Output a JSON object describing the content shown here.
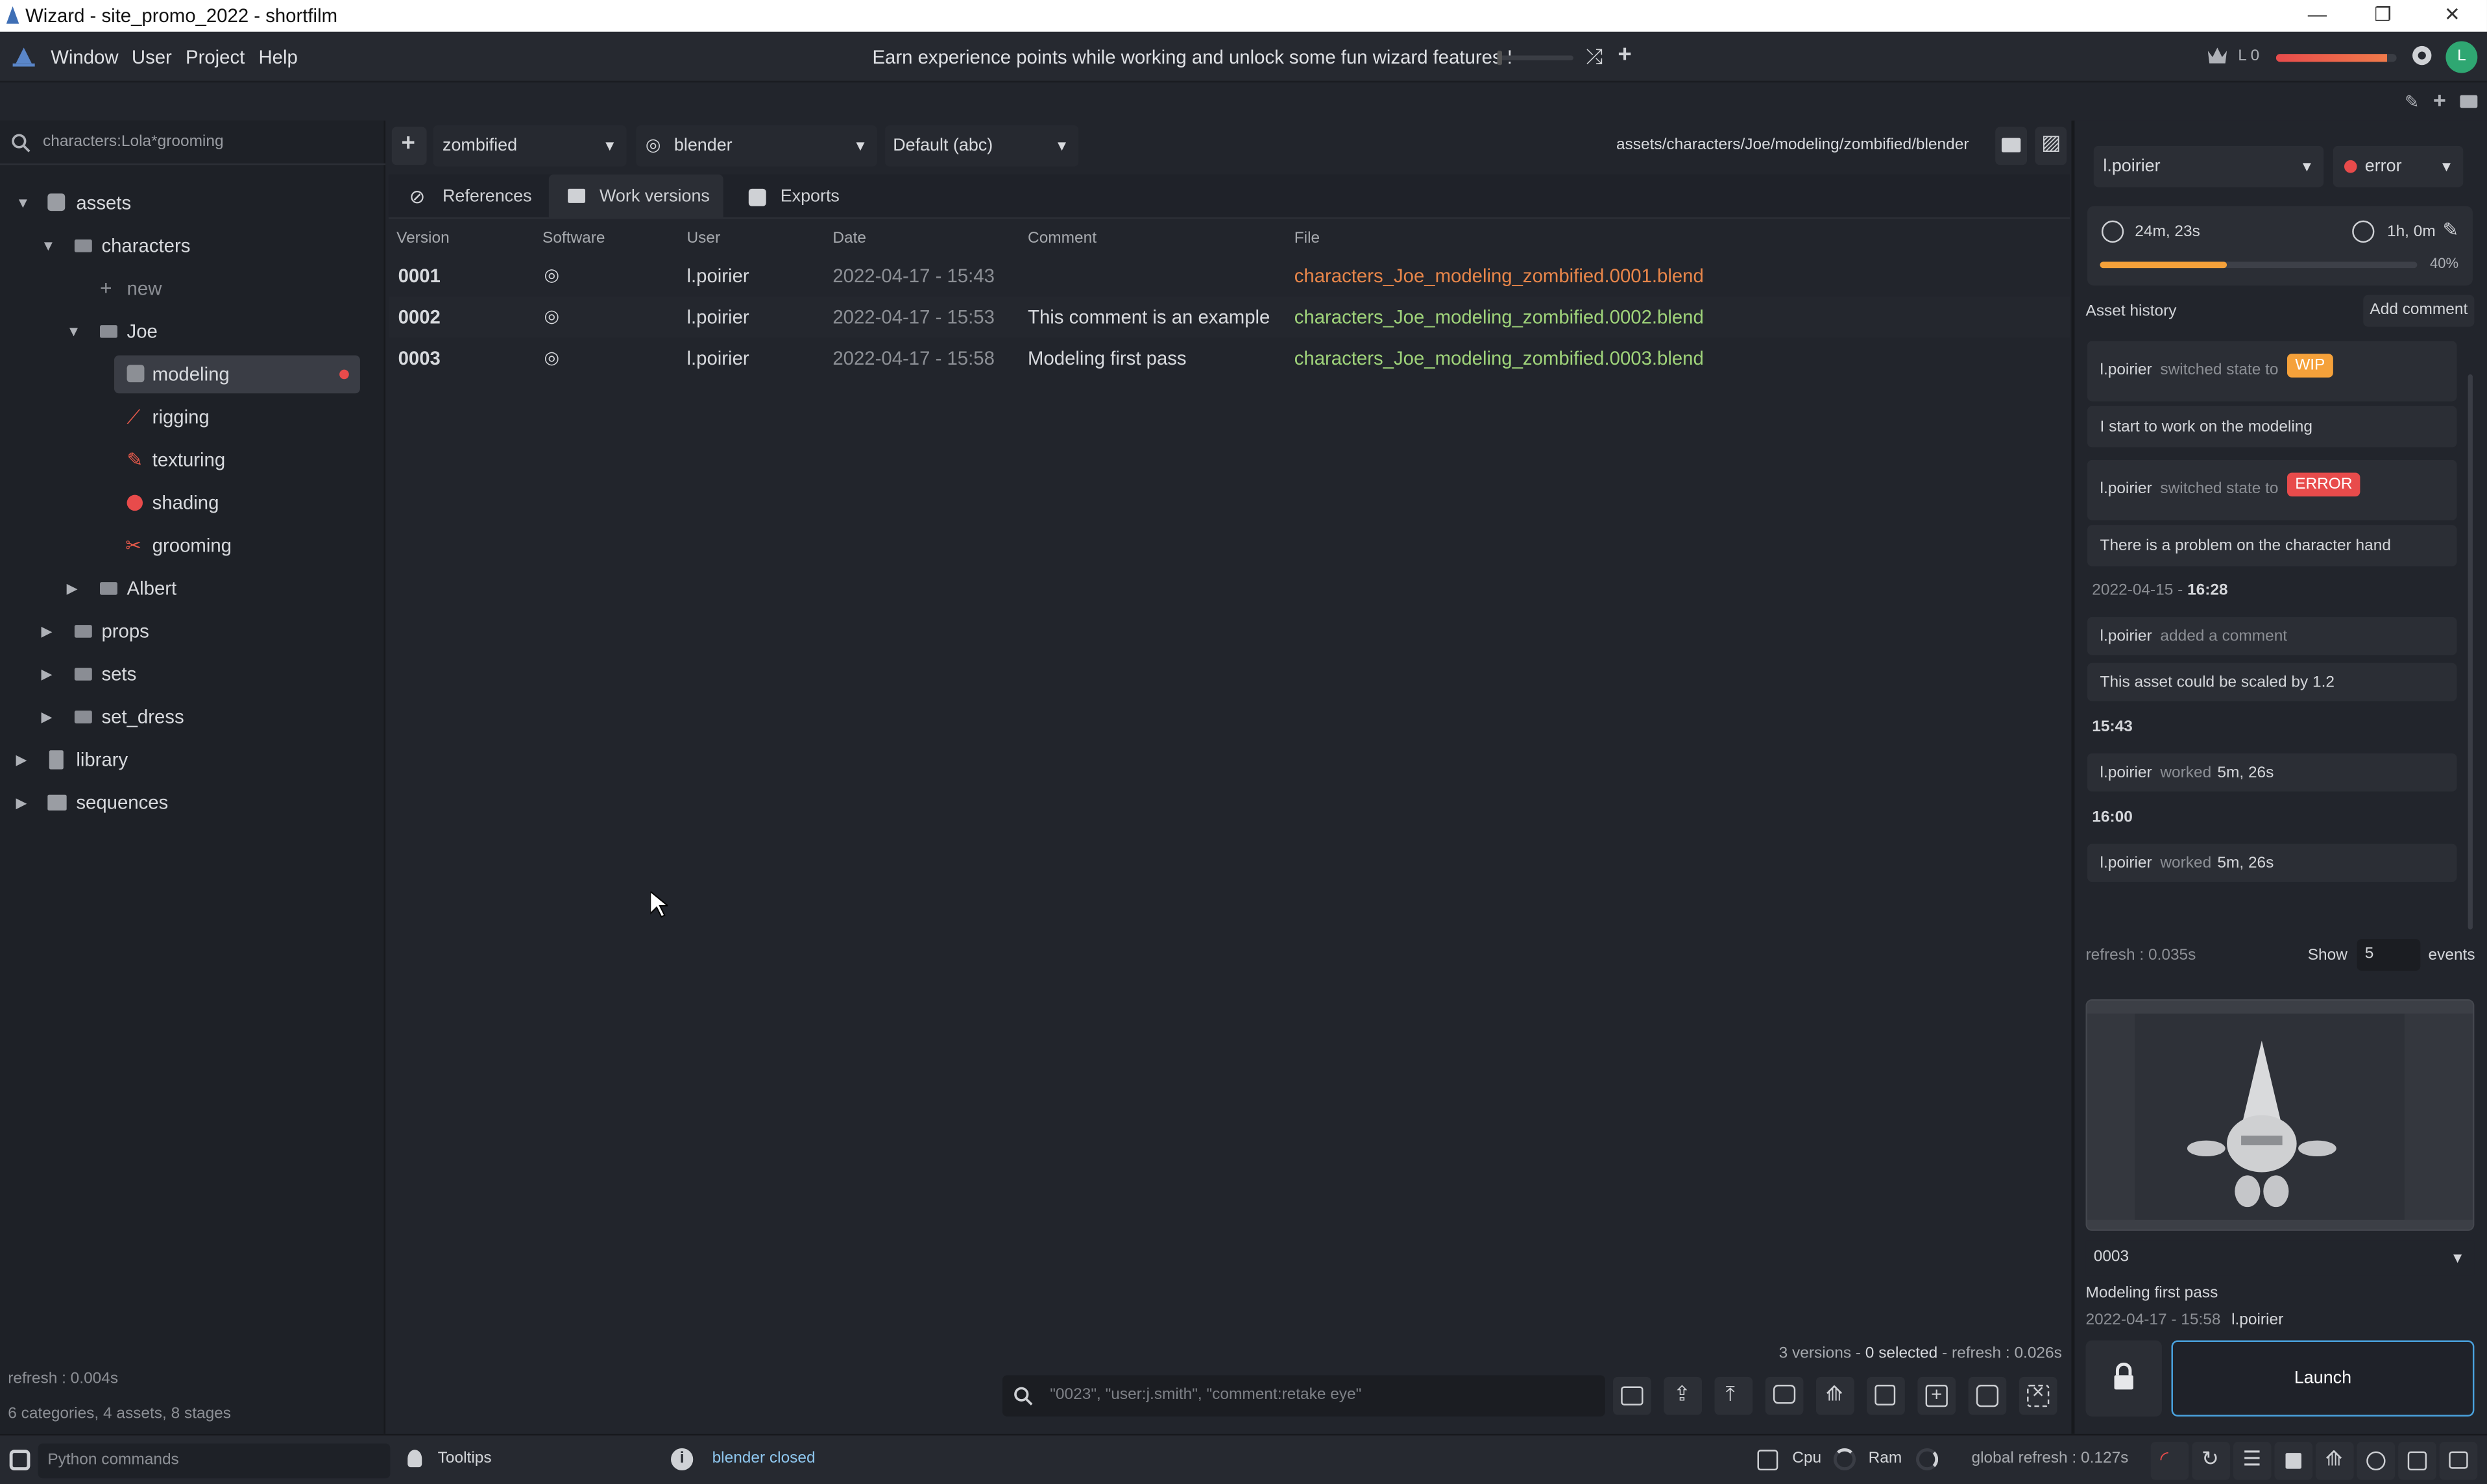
{
  "titlebar": {
    "title": "Wizard - site_promo_2022 - shortfilm"
  },
  "menu": {
    "items": [
      "Window",
      "User",
      "Project",
      "Help"
    ]
  },
  "banner": {
    "text": "Earn experience points while working and unlock some fun wizard features !"
  },
  "user_level": {
    "label": "L 0",
    "avatar_letter": "L"
  },
  "search": {
    "value": "characters:Lola*grooming"
  },
  "tree": {
    "assets": "assets",
    "characters": "characters",
    "new": "new",
    "joe": "Joe",
    "modeling": "modeling",
    "rigging": "rigging",
    "texturing": "texturing",
    "shading": "shading",
    "grooming": "grooming",
    "albert": "Albert",
    "props": "props",
    "sets": "sets",
    "set_dress": "set_dress",
    "library": "library",
    "sequences": "sequences"
  },
  "sidebar_footer": {
    "refresh": "refresh : 0.004s",
    "summary": "6 categories, 4 assets, 8 stages"
  },
  "toolbar": {
    "variant": "zombified",
    "software": "blender",
    "export": "Default (abc)",
    "path": "assets/characters/Joe/modeling/zombified/blender"
  },
  "tabs": {
    "references": "References",
    "work_versions": "Work versions",
    "exports": "Exports"
  },
  "table": {
    "headers": {
      "version": "Version",
      "software": "Software",
      "user": "User",
      "date": "Date",
      "comment": "Comment",
      "file": "File"
    },
    "rows": [
      {
        "version": "0001",
        "user": "l.poirier",
        "date": "2022-04-17 - 15:43",
        "comment": "",
        "file": "characters_Joe_modeling_zombified.0001.blend"
      },
      {
        "version": "0002",
        "user": "l.poirier",
        "date": "2022-04-17 - 15:53",
        "comment": "This comment is an example",
        "file": "characters_Joe_modeling_zombified.0002.blend"
      },
      {
        "version": "0003",
        "user": "l.poirier",
        "date": "2022-04-17 - 15:58",
        "comment": "Modeling first pass",
        "file": "characters_Joe_modeling_zombified.0003.blend"
      }
    ]
  },
  "table_footer": {
    "versions": "3 versions - ",
    "selected": "0 selected",
    "refresh": " - refresh : 0.026s"
  },
  "bottom_search": {
    "placeholder": "\"0023\", \"user:j.smith\", \"comment:retake eye\""
  },
  "right": {
    "user": "l.poirier",
    "state": "error",
    "time_spent": "24m, 23s",
    "estimate": "1h, 0m",
    "progress_label": "40%",
    "progress": 0.4,
    "history_title": "Asset history",
    "add_comment": "Add comment",
    "events": [
      {
        "user": "l.poirier",
        "action": "switched state to",
        "badge": "WIP",
        "text": "I start to work on the modeling"
      },
      {
        "user": "l.poirier",
        "action": "switched state to",
        "badge": "ERROR",
        "text": "There is a problem on the character hand"
      }
    ],
    "date1": "2022-04-15 - ",
    "time1": "16:28",
    "comment_user": "l.poirier",
    "comment_action": "added a comment",
    "comment_text": "This asset could be scaled by 1.2",
    "time2": "15:43",
    "work1_user": "l.poirier",
    "work1_action": "worked",
    "work1_time": "5m, 26s",
    "time3": "16:00",
    "work2_user": "l.poirier",
    "work2_action": "worked",
    "work2_time": "5m, 26s",
    "refresh": "refresh : 0.035s",
    "show_label": "Show",
    "show_value": "5",
    "events_label": "events",
    "version_select": "0003",
    "version_comment": "Modeling first pass",
    "version_date": "2022-04-17 - 15:58",
    "version_user": "l.poirier",
    "launch": "Launch"
  },
  "status": {
    "python_placeholder": "Python commands",
    "tooltips": "Tooltips",
    "message": "blender closed",
    "cpu": "Cpu",
    "ram": "Ram",
    "global_refresh": "global refresh : 0.127s"
  },
  "colors": {
    "accent": "#4aa3df",
    "orange": "#e8864a",
    "green": "#9fd37a",
    "error": "#e84b4b",
    "wip": "#f5a13a"
  }
}
